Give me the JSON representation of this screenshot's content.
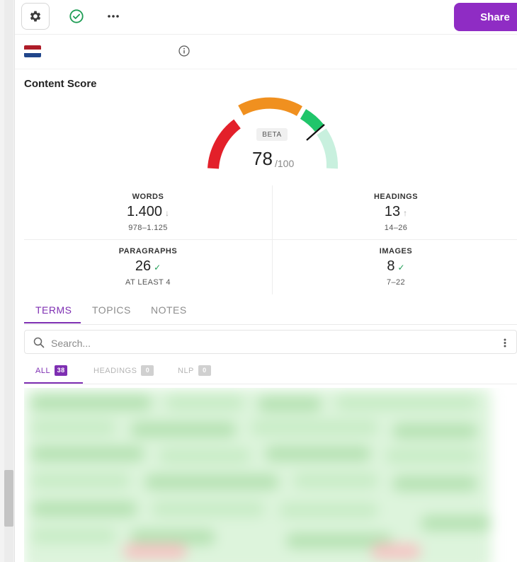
{
  "toolbar": {
    "settings_icon": "gear-icon",
    "check_icon": "check-circle-icon",
    "more_icon": "more-horizontal-icon",
    "share_label": "Share",
    "share_color": "#8f2cc4"
  },
  "keyword": {
    "flag": "netherlands-flag",
    "text": "",
    "info_icon": "info-icon"
  },
  "content_score": {
    "title": "Content Score",
    "badge": "BETA",
    "score": "78",
    "max": "/100",
    "score_fraction": 0.78,
    "segment_colors": [
      "#e3202a",
      "#f0901f",
      "#20c56a",
      "#c8f0de"
    ]
  },
  "metrics": {
    "words": {
      "label": "WORDS",
      "value": "1.400",
      "trend": "↓",
      "range": "978–1.125"
    },
    "headings": {
      "label": "HEADINGS",
      "value": "13",
      "trend": "↑",
      "range": "14–26"
    },
    "paragraphs": {
      "label": "PARAGRAPHS",
      "value": "26",
      "trend": "✓",
      "range": "AT LEAST 4"
    },
    "images": {
      "label": "IMAGES",
      "value": "8",
      "trend": "✓",
      "range": "7–22"
    }
  },
  "tabs": [
    {
      "label": "TERMS",
      "active": true
    },
    {
      "label": "TOPICS",
      "active": false
    },
    {
      "label": "NOTES",
      "active": false
    }
  ],
  "search": {
    "placeholder": "Search...",
    "value": ""
  },
  "subtabs": [
    {
      "label": "ALL",
      "count": "38",
      "active": true
    },
    {
      "label": "HEADINGS",
      "count": "0",
      "active": false
    },
    {
      "label": "NLP",
      "count": "0",
      "active": false
    }
  ]
}
